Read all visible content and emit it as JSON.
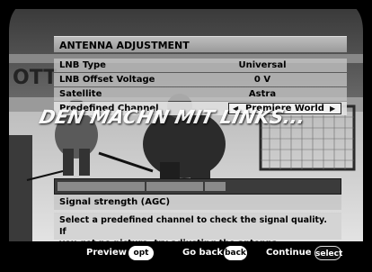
{
  "panel": {
    "title": "ANTENNA ADJUSTMENT",
    "rows": [
      {
        "label": "LNB Type",
        "value": "Universal"
      },
      {
        "label": "LNB Offset Voltage",
        "value": "0 V"
      },
      {
        "label": "Satellite",
        "value": "Astra"
      },
      {
        "label": "Predefined Channel",
        "value": "Premiere World"
      }
    ],
    "signal_label": "Signal strength (AGC)",
    "signal_level": 0.6,
    "help_text_line1": "Select a predefined channel to check the signal quality. If",
    "help_text_line2": "you get no picture, try adjusting the antenna"
  },
  "background": {
    "scoreboard_text": "OTT",
    "ticker_text": "DEN MACHN MIT LINKS..."
  },
  "footer": {
    "preview_label": "Preview",
    "preview_key": "opt",
    "goback_label": "Go back",
    "goback_key": "back",
    "continue_label": "Continue",
    "continue_key": "select"
  },
  "icons": {
    "left_arrow": "left-arrow-icon",
    "right_arrow": "right-arrow-icon"
  }
}
